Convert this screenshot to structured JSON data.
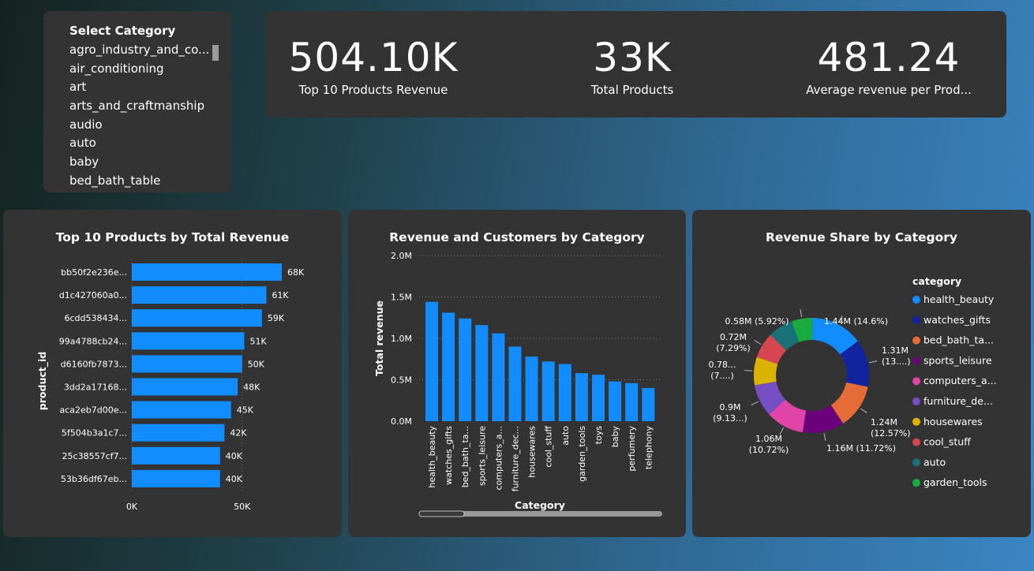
{
  "slicer": {
    "title": "Select Category",
    "items": [
      "agro_industry_and_co...",
      "air_conditioning",
      "art",
      "arts_and_craftmanship",
      "audio",
      "auto",
      "baby",
      "bed_bath_table"
    ]
  },
  "kpis": [
    {
      "value": "504.10K",
      "label": "Top 10 Products Revenue"
    },
    {
      "value": "33K",
      "label": "Total Products"
    },
    {
      "value": "481.24",
      "label": "Average revenue per Prod..."
    }
  ],
  "colors": {
    "bar": "#118DFF",
    "card": "#333333",
    "grid": "#777777"
  },
  "chart_data": [
    {
      "type": "bar",
      "orientation": "horizontal",
      "title": "Top 10 Products by Total Revenue",
      "ylabel": "product_id",
      "xlabel": "",
      "categories": [
        "bb50f2e236e...",
        "d1c427060a0...",
        "6cdd538434...",
        "99a4788cb24...",
        "d6160fb7873...",
        "3dd2a17168...",
        "aca2eb7d00e...",
        "5f504b3a1c7...",
        "25c38557cf7...",
        "53b36df67eb..."
      ],
      "values": [
        68,
        61,
        59,
        51,
        50,
        48,
        45,
        42,
        40,
        40
      ],
      "data_labels": [
        "68K",
        "61K",
        "59K",
        "51K",
        "50K",
        "48K",
        "45K",
        "42K",
        "40K",
        "40K"
      ],
      "xticks": [
        {
          "value": 0,
          "label": "0K"
        },
        {
          "value": 50,
          "label": "50K"
        }
      ],
      "xlim": [
        0,
        75
      ]
    },
    {
      "type": "bar",
      "title": "Revenue and Customers by Category",
      "xlabel": "Category",
      "ylabel": "Total revenue",
      "categories": [
        "health_beauty",
        "watches_gifts",
        "bed_bath_ta...",
        "sports_leisure",
        "computers_a...",
        "furniture_dec...",
        "housewares",
        "cool_stuff",
        "auto",
        "garden_tools",
        "toys",
        "baby",
        "perfumery",
        "telephony"
      ],
      "values": [
        1.44,
        1.31,
        1.24,
        1.16,
        1.06,
        0.9,
        0.78,
        0.72,
        0.69,
        0.58,
        0.56,
        0.48,
        0.46,
        0.4
      ],
      "yticks": [
        {
          "value": 0,
          "label": "0.0M"
        },
        {
          "value": 0.5,
          "label": "0.5M"
        },
        {
          "value": 1.0,
          "label": "1.0M"
        },
        {
          "value": 1.5,
          "label": "1.5M"
        },
        {
          "value": 2.0,
          "label": "2.0M"
        }
      ],
      "ylim": [
        0,
        2.0
      ],
      "scrollbar": true
    },
    {
      "type": "pie",
      "donut": true,
      "title": "Revenue Share by Category",
      "legend_title": "category",
      "legend_position": "right",
      "slices": [
        {
          "name": "health_beauty",
          "legend": "health_beauty",
          "value": 14.6,
          "color": "#118DFF",
          "label": [
            "1.44M (14.6%)"
          ]
        },
        {
          "name": "watches_gifts",
          "legend": "watches_gifts",
          "value": 13.3,
          "color": "#12239E",
          "label": [
            "1.31M",
            "(13....)"
          ]
        },
        {
          "name": "bed_bath_table",
          "legend": "bed_bath_ta...",
          "value": 12.57,
          "color": "#E66C37",
          "label": [
            "1.24M",
            "(12.57%)"
          ]
        },
        {
          "name": "sports_leisure",
          "legend": "sports_leisure",
          "value": 11.72,
          "color": "#6B007B",
          "label": [
            "1.16M (11.72%)"
          ]
        },
        {
          "name": "computers_accessories",
          "legend": "computers_a...",
          "value": 10.72,
          "color": "#E044A7",
          "label": [
            "1.06M",
            "(10.72%)"
          ]
        },
        {
          "name": "furniture_decor",
          "legend": "furniture_de...",
          "value": 9.13,
          "color": "#744EC2",
          "label": [
            "0.9M",
            "(9.13...)"
          ]
        },
        {
          "name": "housewares",
          "legend": "housewares",
          "value": 7.9,
          "color": "#D9B300",
          "label": [
            "0.78...",
            "(7....)"
          ]
        },
        {
          "name": "cool_stuff",
          "legend": "cool_stuff",
          "value": 7.29,
          "color": "#D64550",
          "label": [
            "0.72M",
            "(7.29%)"
          ]
        },
        {
          "name": "auto",
          "legend": "auto",
          "value": 6.98,
          "color": "#197278",
          "label": []
        },
        {
          "name": "garden_tools",
          "legend": "garden_tools",
          "value": 5.92,
          "color": "#1AAB40",
          "label": [
            "0.58M (5.92%)"
          ]
        }
      ]
    }
  ]
}
